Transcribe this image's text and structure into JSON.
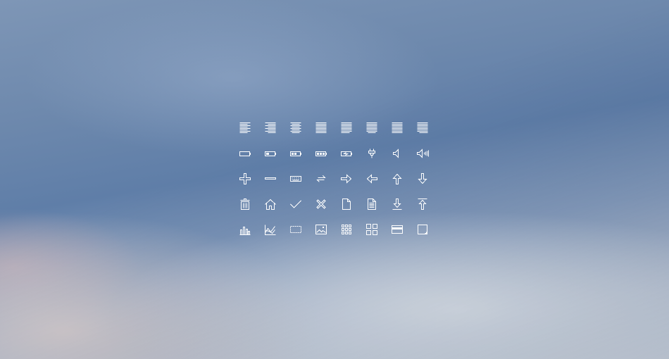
{
  "icons": [
    [
      "align-left-icon",
      "align-right-icon",
      "align-center-icon",
      "align-justify-icon",
      "justify-left-icon",
      "justify-center-icon",
      "justify-all-icon",
      "justify-right-icon"
    ],
    [
      "battery-empty-icon",
      "battery-low-icon",
      "battery-half-icon",
      "battery-full-icon",
      "battery-charging-icon",
      "plug-icon",
      "volume-low-icon",
      "volume-high-icon"
    ],
    [
      "plus-icon",
      "minus-icon",
      "keyboard-icon",
      "swap-icon",
      "arrow-right-icon",
      "arrow-left-icon",
      "arrow-up-icon",
      "arrow-down-icon"
    ],
    [
      "trash-icon",
      "home-icon",
      "checkmark-icon",
      "close-icon",
      "document-icon",
      "document-text-icon",
      "download-icon",
      "upload-icon"
    ],
    [
      "bar-chart-icon",
      "line-chart-icon",
      "selection-icon",
      "image-icon",
      "grid-9-icon",
      "grid-4-icon",
      "credit-card-icon",
      "resize-icon"
    ]
  ],
  "colors": {
    "icon": "#ffffff",
    "sky_top": "#6e89ad",
    "sky_bottom": "#dfe2e6"
  }
}
